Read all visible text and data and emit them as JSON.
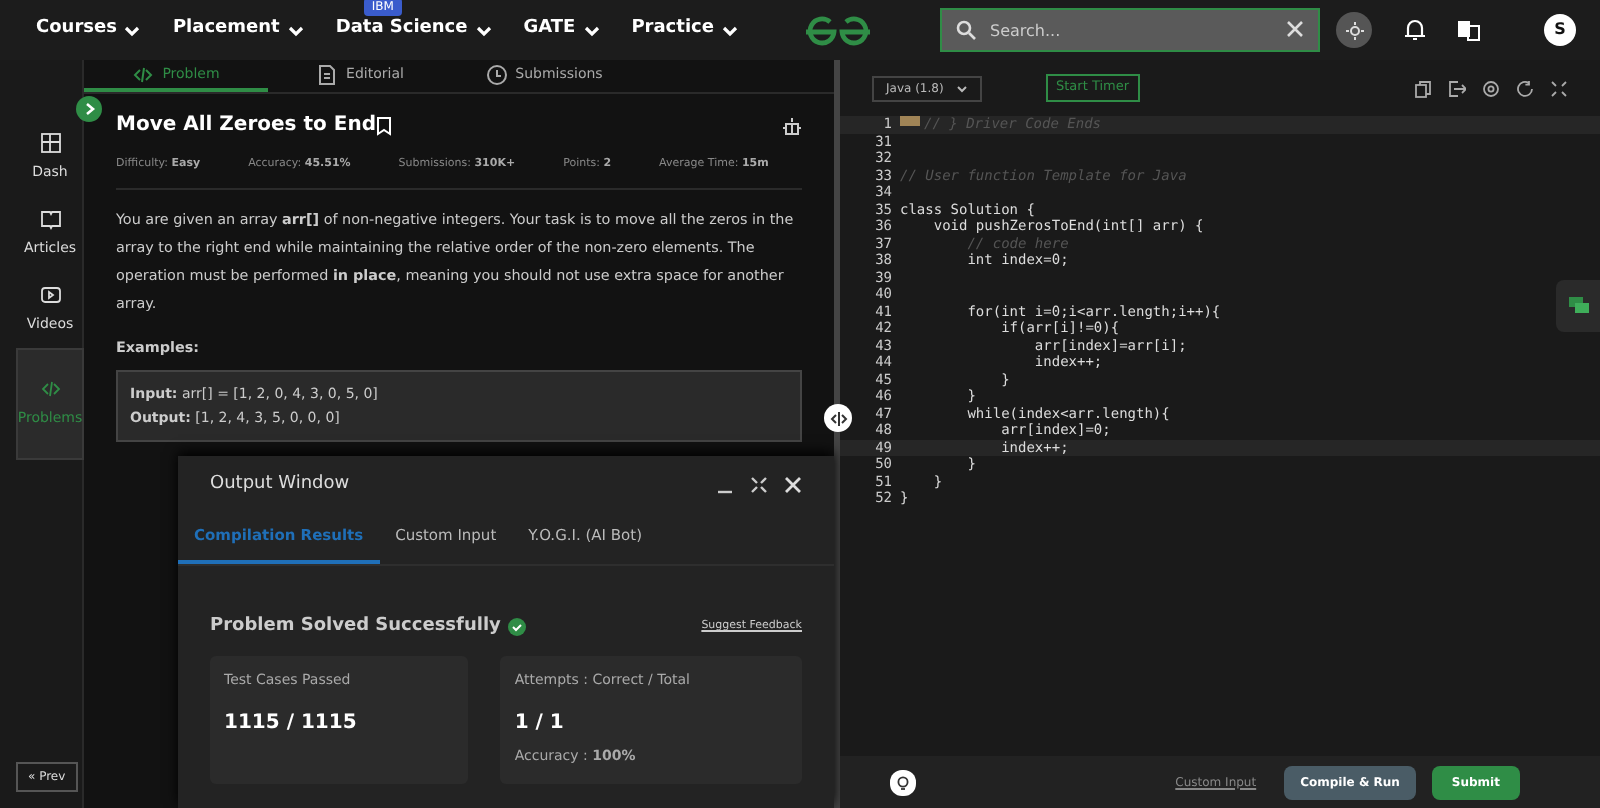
{
  "nav": {
    "items": [
      {
        "label": "Courses"
      },
      {
        "label": "Placement"
      },
      {
        "label": "Data Science",
        "badge": "IBM"
      },
      {
        "label": "GATE"
      },
      {
        "label": "Practice"
      }
    ],
    "search": {
      "placeholder": "Search..."
    },
    "avatar": "S"
  },
  "sidebar": {
    "items": [
      {
        "label": "Dash",
        "selected": false
      },
      {
        "label": "Articles",
        "selected": false
      },
      {
        "label": "Videos",
        "selected": false
      },
      {
        "label": "Problems",
        "selected": true
      }
    ],
    "prev": "« Prev"
  },
  "tabs": [
    {
      "label": "Problem",
      "selected": true
    },
    {
      "label": "Editorial",
      "selected": false
    },
    {
      "label": "Submissions",
      "selected": false
    }
  ],
  "problem": {
    "title": "Move All Zeroes to End",
    "meta": [
      "Difficulty: **Easy**",
      "Accuracy: **45.51%**",
      "Submissions: **310K+**",
      "Points: **2**",
      "Average Time: **15m**"
    ],
    "description": "You are given an array **arr[]** of non-negative integers. Your task is to move all the zeros in the array to the right end while maintaining the relative order of the non-zero elements. The operation must be performed **in place**, meaning you should not use extra space for another array.",
    "examples_heading": "Examples:",
    "example": [
      "**Input:** arr[] = [1, 2, 0, 4, 3, 0, 5, 0]",
      "**Output:** [1, 2, 4, 3, 5, 0, 0, 0]"
    ]
  },
  "output_window": {
    "title": "Output Window",
    "tabs": [
      {
        "label": "Compilation Results",
        "selected": true
      },
      {
        "label": "Custom Input",
        "selected": false
      },
      {
        "label": "Y.O.G.I. (AI Bot)",
        "selected": false
      }
    ],
    "status": "Problem Solved Successfully",
    "feedback": "Suggest Feedback",
    "cards": [
      {
        "label": "Test Cases Passed",
        "value": "1115 / 1115"
      },
      {
        "label": "Attempts : Correct / Total",
        "value": "1 / 1",
        "note": "Accuracy : **100%**"
      }
    ]
  },
  "editor": {
    "language": "Java (1.8)",
    "timer": "Start Timer",
    "lines": [
      {
        "no": "1",
        "code": "// } Driver Code Ends",
        "kind": "comment",
        "highlighted": true,
        "folded": true
      },
      {
        "no": "31",
        "highlighted": false,
        "folded": false
      },
      {
        "no": "32",
        "highlighted": false,
        "folded": false
      },
      {
        "no": "33",
        "code": "// User function Template for Java",
        "kind": "comment",
        "highlighted": false,
        "folded": false
      },
      {
        "no": "34",
        "highlighted": false,
        "folded": false
      },
      {
        "no": "35",
        "code": "class Solution {",
        "kind": "code",
        "highlighted": false,
        "folded": false
      },
      {
        "no": "36",
        "code": "    void pushZerosToEnd(int[] arr) {",
        "kind": "code",
        "highlighted": false,
        "folded": false
      },
      {
        "no": "37",
        "code": "        // code here",
        "kind": "comment",
        "highlighted": false,
        "folded": false
      },
      {
        "no": "38",
        "code": "        int index=0;",
        "kind": "code",
        "highlighted": false,
        "folded": false
      },
      {
        "no": "39",
        "highlighted": false,
        "folded": false
      },
      {
        "no": "40",
        "highlighted": false,
        "folded": false
      },
      {
        "no": "41",
        "code": "        for(int i=0;i<arr.length;i++){",
        "kind": "code",
        "highlighted": false,
        "folded": false
      },
      {
        "no": "42",
        "code": "            if(arr[i]!=0){",
        "kind": "code",
        "highlighted": false,
        "folded": false
      },
      {
        "no": "43",
        "code": "                arr[index]=arr[i];",
        "kind": "code",
        "highlighted": false,
        "folded": false
      },
      {
        "no": "44",
        "code": "                index++;",
        "kind": "code",
        "highlighted": false,
        "folded": false
      },
      {
        "no": "45",
        "code": "            }",
        "kind": "code",
        "highlighted": false,
        "folded": false
      },
      {
        "no": "46",
        "code": "        }",
        "kind": "code",
        "highlighted": false,
        "folded": false
      },
      {
        "no": "47",
        "code": "        while(index<arr.length){",
        "kind": "code",
        "highlighted": false,
        "folded": false
      },
      {
        "no": "48",
        "code": "            arr[index]=0;",
        "kind": "code",
        "highlighted": false,
        "folded": false
      },
      {
        "no": "49",
        "code": "            index++;",
        "kind": "code",
        "highlighted": true,
        "folded": false
      },
      {
        "no": "50",
        "code": "        }",
        "kind": "code",
        "highlighted": false,
        "folded": false
      },
      {
        "no": "51",
        "code": "    }",
        "kind": "code",
        "highlighted": false,
        "folded": false
      },
      {
        "no": "52",
        "code": "}",
        "kind": "code",
        "highlighted": false,
        "folded": false
      }
    ],
    "custom_input": "Custom Input",
    "compile": "Compile & Run",
    "submit": "Submit"
  }
}
